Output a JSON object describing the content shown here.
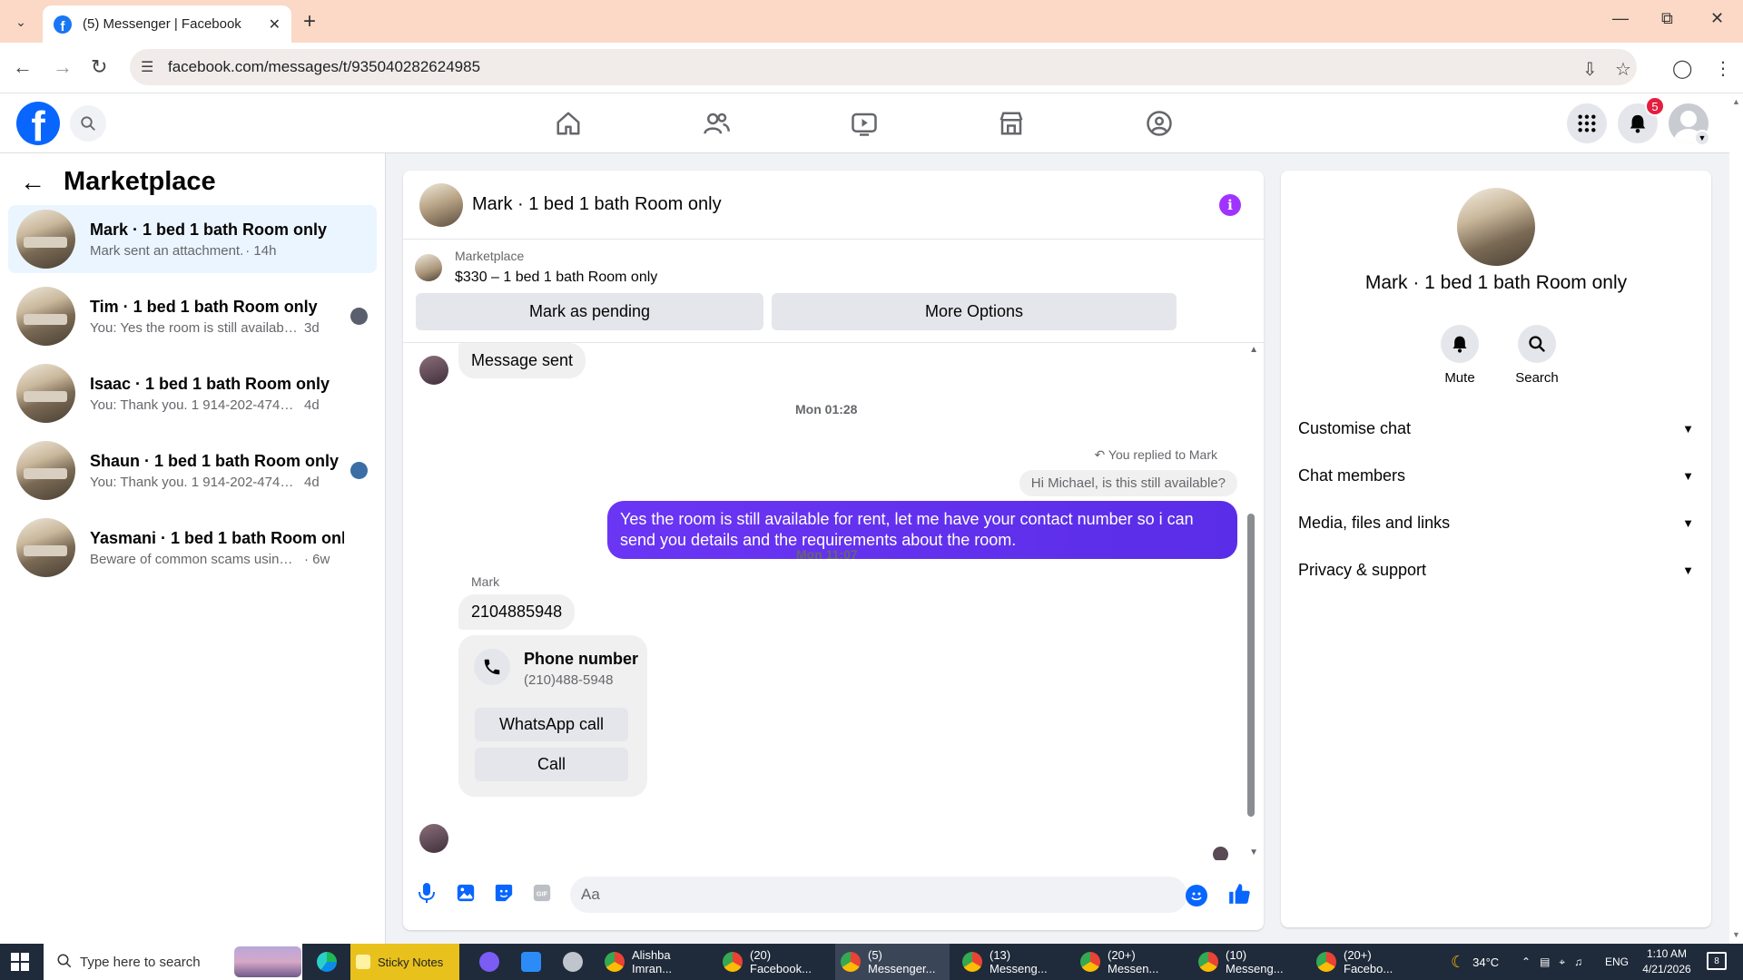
{
  "browser": {
    "tab_title": "(5) Messenger | Facebook",
    "url": "facebook.com/messages/t/935040282624985"
  },
  "fb_header": {
    "notification_count": "5"
  },
  "left_panel": {
    "title": "Marketplace",
    "conversations": [
      {
        "name": "Mark · 1 bed 1 bath Room only",
        "snippet": "Mark sent an attachment.",
        "time": "· 14h"
      },
      {
        "name": "Tim · 1 bed 1 bath Room only",
        "snippet": "You: Yes the room is still available f...",
        "time": "3d"
      },
      {
        "name": "Isaac · 1 bed 1 bath Room only",
        "snippet": "You: Thank you. 1 914-202-4741 is the...",
        "time": "4d"
      },
      {
        "name": "Shaun · 1 bed 1 bath Room only",
        "snippet": "You: Thank you. 1 914-202-4741 is ...",
        "time": "4d"
      },
      {
        "name": "Yasmani · 1 bed 1 bath Room only",
        "snippet": "Beware of common scams using pay...",
        "time": "· 6w"
      }
    ]
  },
  "chat": {
    "title": "Mark · 1 bed 1 bath Room only",
    "marketplace": {
      "label": "Marketplace",
      "listing": "$330 – 1 bed 1 bath Room only",
      "mark_pending": "Mark as pending",
      "more_options": "More Options"
    },
    "messages": {
      "first_message": "Message sent",
      "timestamp_1": "Mon 01:28",
      "replied_label": "You replied to Mark",
      "quoted_text": "Hi Michael, is this still available?",
      "outgoing_text": "Yes the room is still available for rent, let me have your contact number so i can send you details and the requirements about the room.",
      "timestamp_2": "Mon 11:07",
      "sender_name": "Mark",
      "phone_message": "2104885948",
      "contact_card": {
        "title": "Phone number",
        "phone": "(210)488-5948",
        "whatsapp": "WhatsApp call",
        "call": "Call"
      }
    },
    "composer": {
      "placeholder": "Aa"
    }
  },
  "right_panel": {
    "name": "Mark · 1 bed 1 bath Room only",
    "mute": "Mute",
    "search": "Search",
    "sections": [
      "Customise chat",
      "Chat members",
      "Media, files and links",
      "Privacy & support"
    ]
  },
  "taskbar": {
    "search_placeholder": "Type here to search",
    "apps": [
      "Sticky Notes",
      "Alishba Imran...",
      "(20) Facebook...",
      "(5) Messenger...",
      "(13) Messeng...",
      "(20+) Messen...",
      "(10) Messeng...",
      "(20+) Facebo..."
    ],
    "weather": "34°C",
    "language": "ENG",
    "time": "1:10 AM",
    "date": "4/21/2026",
    "notifications": "8"
  }
}
